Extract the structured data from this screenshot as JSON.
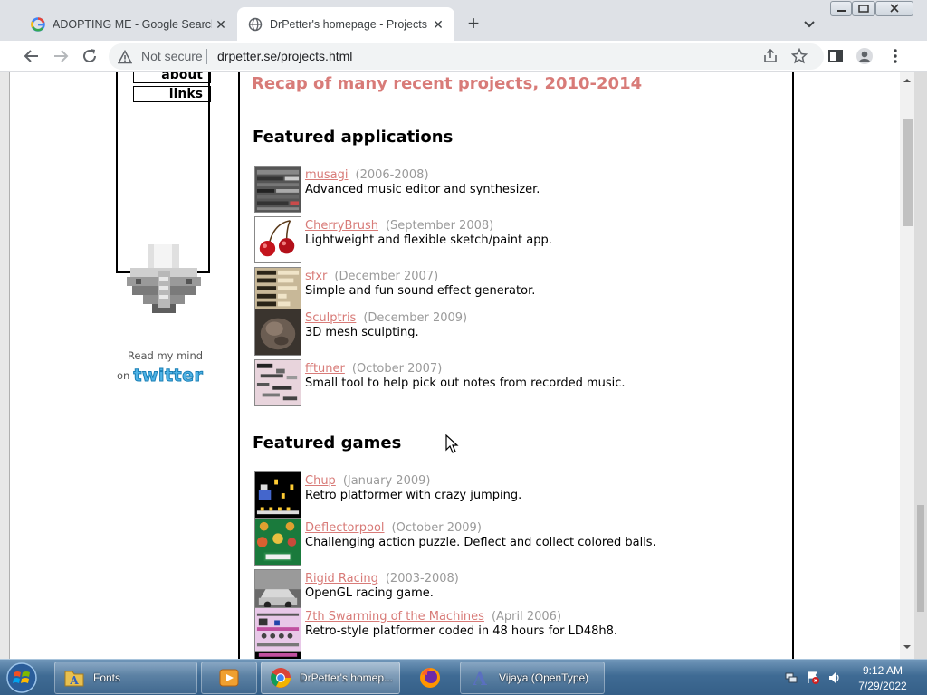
{
  "browser": {
    "tabs": [
      {
        "label": "ADOPTING ME - Google Search",
        "icon": "google-icon"
      },
      {
        "label": "DrPetter's homepage - Projects",
        "icon": "globe-icon"
      }
    ],
    "new_tab_symbol": "+",
    "close_symbol": "✕",
    "security_label": "Not secure",
    "url": "drpetter.se/projects.html"
  },
  "sidebar": {
    "nav": [
      {
        "label": "about"
      },
      {
        "label": "links"
      }
    ],
    "read_mind": "Read my mind",
    "on_label": "on",
    "twitter_label": "twitter",
    "twitter_color": "#4fb3e6"
  },
  "main": {
    "recap_link": "Recap of many recent projects, 2010-2014",
    "apps_heading": "Featured applications",
    "games_heading": "Featured games",
    "link_color": "#d87b78",
    "date_color": "#9a9a9a",
    "applications": [
      {
        "name": "musagi",
        "date": "(2006-2008)",
        "desc": "Advanced music editor and synthesizer."
      },
      {
        "name": "CherryBrush",
        "date": "(September 2008)",
        "desc": "Lightweight and flexible sketch/paint app."
      },
      {
        "name": "sfxr",
        "date": "(December 2007)",
        "desc": "Simple and fun sound effect generator."
      },
      {
        "name": "Sculptris",
        "date": "(December 2009)",
        "desc": "3D mesh sculpting."
      },
      {
        "name": "fftuner",
        "date": "(October 2007)",
        "desc": "Small tool to help pick out notes from recorded music."
      }
    ],
    "games": [
      {
        "name": "Chup",
        "date": "(January 2009)",
        "desc": "Retro platformer with crazy jumping."
      },
      {
        "name": "Deflectorpool",
        "date": "(October 2009)",
        "desc": "Challenging action puzzle. Deflect and collect colored balls."
      },
      {
        "name": "Rigid Racing",
        "date": "(2003-2008)",
        "desc": "OpenGL racing game."
      },
      {
        "name": "7th Swarming of the Machines",
        "date": "(April 2006)",
        "desc": "Retro-style platformer coded in 48 hours for LD48h8."
      }
    ]
  },
  "taskbar": {
    "items": [
      {
        "label": "Fonts",
        "icon": "folder-icon"
      },
      {
        "label": "",
        "icon": "media-player-icon"
      },
      {
        "label": "DrPetter's homep...",
        "icon": "chrome-icon"
      },
      {
        "label": "",
        "icon": "firefox-icon"
      },
      {
        "label": "Vijaya (OpenType)",
        "icon": "font-viewer-icon"
      }
    ],
    "time": "9:12 AM",
    "date": "7/29/2022"
  }
}
